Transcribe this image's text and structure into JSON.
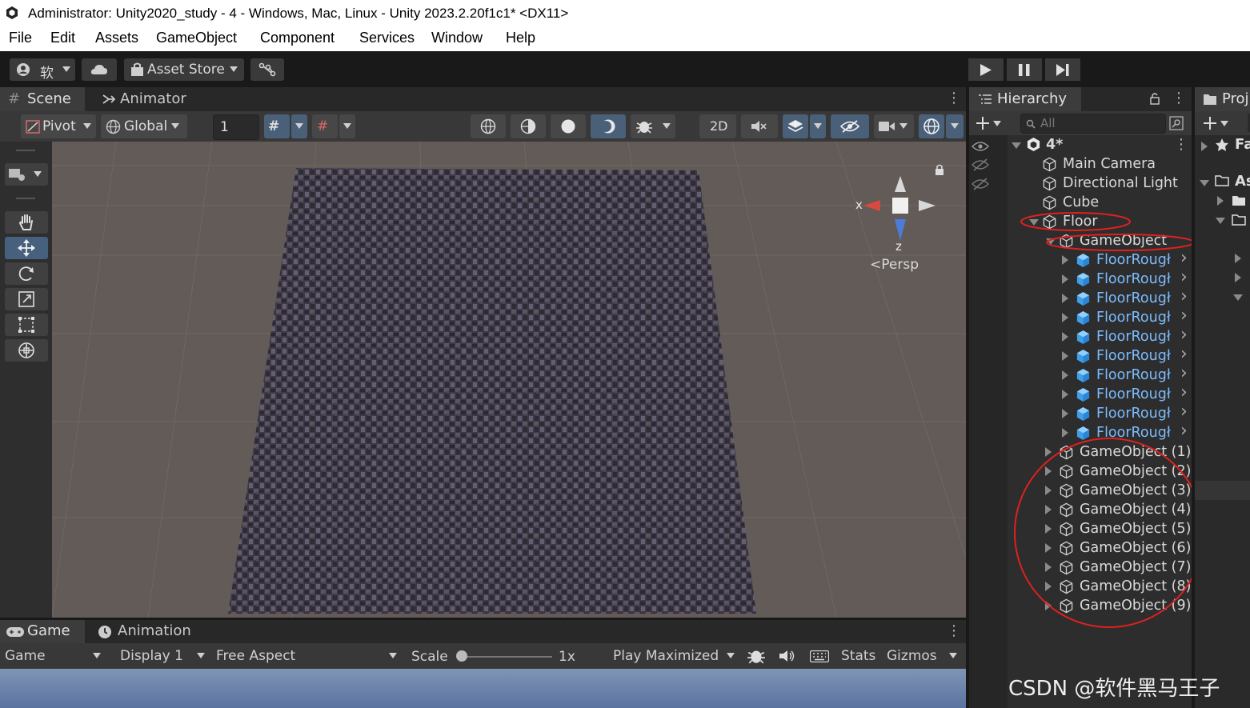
{
  "window": {
    "title": "Administrator: Unity2020_study - 4 - Windows, Mac, Linux - Unity 2023.2.20f1c1* <DX11>"
  },
  "menu": [
    "File",
    "Edit",
    "Assets",
    "GameObject",
    "Component",
    "Services",
    "Window",
    "Help"
  ],
  "toolbar": {
    "account_label": "软",
    "asset_store_label": "Asset Store"
  },
  "scene": {
    "tabs": [
      "Scene",
      "Animator"
    ],
    "pivot_label": "Pivot",
    "global_label": "Global",
    "grid_value": "1",
    "mode_2d_label": "2D",
    "gizmo_x_label": "x",
    "gizmo_z_label": "z",
    "persp_label": "Persp"
  },
  "game": {
    "tabs": [
      "Game",
      "Animation"
    ],
    "view_select": "Game",
    "display_select": "Display 1",
    "aspect_select": "Free Aspect",
    "scale_label": "Scale",
    "scale_value": "1x",
    "play_mode_select": "Play Maximized",
    "stats_label": "Stats",
    "gizmos_label": "Gizmos"
  },
  "hierarchy": {
    "tab_label": "Hierarchy",
    "search_placeholder": "All",
    "scene_name": "4*",
    "items": [
      {
        "label": "Main Camera",
        "depth": 1
      },
      {
        "label": "Directional Light",
        "depth": 1
      },
      {
        "label": "Cube",
        "depth": 1
      },
      {
        "label": "Floor",
        "depth": 1,
        "expanded": true
      },
      {
        "label": "GameObject",
        "depth": 2,
        "expanded": true
      },
      {
        "label": "FloorRougł",
        "depth": 3,
        "prefab": true
      },
      {
        "label": "FloorRougł",
        "depth": 3,
        "prefab": true
      },
      {
        "label": "FloorRougł",
        "depth": 3,
        "prefab": true
      },
      {
        "label": "FloorRougł",
        "depth": 3,
        "prefab": true
      },
      {
        "label": "FloorRougł",
        "depth": 3,
        "prefab": true
      },
      {
        "label": "FloorRougł",
        "depth": 3,
        "prefab": true
      },
      {
        "label": "FloorRougł",
        "depth": 3,
        "prefab": true
      },
      {
        "label": "FloorRougł",
        "depth": 3,
        "prefab": true
      },
      {
        "label": "FloorRougł",
        "depth": 3,
        "prefab": true
      },
      {
        "label": "FloorRougł",
        "depth": 3,
        "prefab": true
      },
      {
        "label": "GameObject (1)",
        "depth": 2
      },
      {
        "label": "GameObject (2)",
        "depth": 2
      },
      {
        "label": "GameObject (3)",
        "depth": 2
      },
      {
        "label": "GameObject (4)",
        "depth": 2
      },
      {
        "label": "GameObject (5)",
        "depth": 2
      },
      {
        "label": "GameObject (6)",
        "depth": 2
      },
      {
        "label": "GameObject (7)",
        "depth": 2
      },
      {
        "label": "GameObject (8)",
        "depth": 2
      },
      {
        "label": "GameObject (9)",
        "depth": 2
      }
    ]
  },
  "project": {
    "tab_label": "Proj",
    "favorites_label": "Fa",
    "assets_label": "As"
  },
  "watermark": "CSDN @软件黑马王子"
}
